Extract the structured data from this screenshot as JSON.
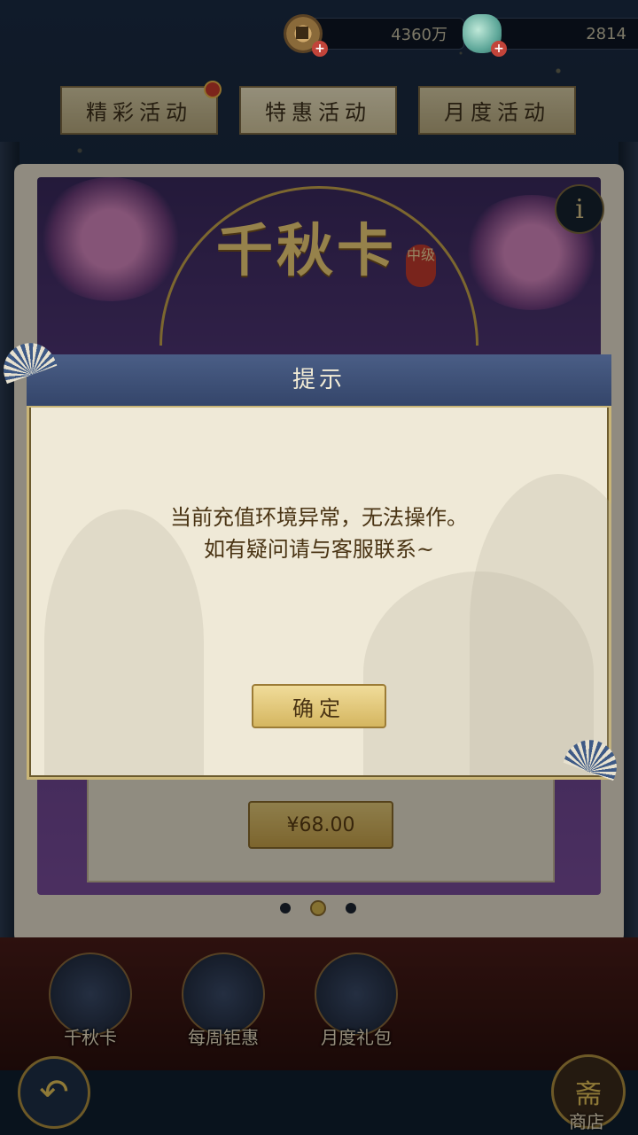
{
  "currency": {
    "coins": "4360万",
    "jade": "2814",
    "coin_icon": "copper-coin-icon",
    "jade_icon": "jade-pouch-icon",
    "plus_icon": "plus-icon"
  },
  "tabs": [
    {
      "label": "精彩活动",
      "has_badge": true
    },
    {
      "label": "特惠活动",
      "active": true
    },
    {
      "label": "月度活动"
    }
  ],
  "card": {
    "title": "千秋卡",
    "tier": "中级",
    "price": "¥68.00",
    "info_icon": "i"
  },
  "dialog": {
    "title": "提示",
    "message_line1": "当前充值环境异常，无法操作。",
    "message_line2": "如有疑问请与客服联系~",
    "confirm_label": "确定"
  },
  "shelf": [
    {
      "label": "千秋卡"
    },
    {
      "label": "每周钜惠"
    },
    {
      "label": "月度礼包"
    }
  ],
  "shop": {
    "label": "商店",
    "icon_char": "斋"
  },
  "carousel": {
    "count": 3,
    "active_index": 1
  },
  "colors": {
    "dialog_header": "#3f5278",
    "dialog_body": "#efe9d7",
    "gold_button": "#d5b660",
    "text_brown": "#4a3414"
  }
}
